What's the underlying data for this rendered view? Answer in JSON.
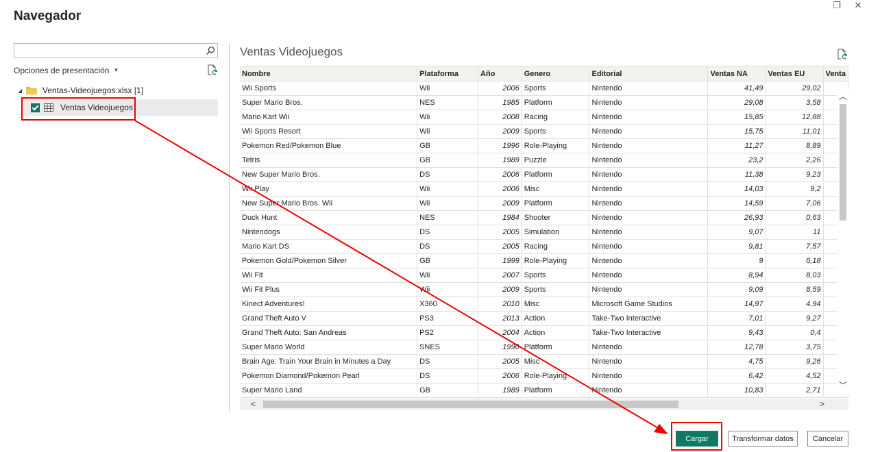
{
  "window": {
    "title": "Navegador"
  },
  "left_panel": {
    "search": {
      "value": "",
      "placeholder": ""
    },
    "display_options": "Opciones de presentación",
    "file": "Ventas-Videojuegos.xlsx [1]",
    "item": "Ventas Videojuegos"
  },
  "preview": {
    "title": "Ventas Videojuegos",
    "columns": [
      "Nombre",
      "Plataforma",
      "Año",
      "Genero",
      "Editorial",
      "Ventas NA",
      "Ventas EU",
      "Venta"
    ],
    "rows": [
      [
        "Wii Sports",
        "Wii",
        "2006",
        "Sports",
        "Nintendo",
        "41,49",
        "29,02"
      ],
      [
        "Super Mario Bros.",
        "NES",
        "1985",
        "Platform",
        "Nintendo",
        "29,08",
        "3,58"
      ],
      [
        "Mario Kart Wii",
        "Wii",
        "2008",
        "Racing",
        "Nintendo",
        "15,85",
        "12,88"
      ],
      [
        "Wii Sports Resort",
        "Wii",
        "2009",
        "Sports",
        "Nintendo",
        "15,75",
        "11,01"
      ],
      [
        "Pokemon Red/Pokemon Blue",
        "GB",
        "1996",
        "Role-Playing",
        "Nintendo",
        "11,27",
        "8,89"
      ],
      [
        "Tetris",
        "GB",
        "1989",
        "Puzzle",
        "Nintendo",
        "23,2",
        "2,26"
      ],
      [
        "New Super Mario Bros.",
        "DS",
        "2006",
        "Platform",
        "Nintendo",
        "11,38",
        "9,23"
      ],
      [
        "Wii Play",
        "Wii",
        "2006",
        "Misc",
        "Nintendo",
        "14,03",
        "9,2"
      ],
      [
        "New Super Mario Bros. Wii",
        "Wii",
        "2009",
        "Platform",
        "Nintendo",
        "14,59",
        "7,06"
      ],
      [
        "Duck Hunt",
        "NES",
        "1984",
        "Shooter",
        "Nintendo",
        "26,93",
        "0,63"
      ],
      [
        "Nintendogs",
        "DS",
        "2005",
        "Simulation",
        "Nintendo",
        "9,07",
        "11"
      ],
      [
        "Mario Kart DS",
        "DS",
        "2005",
        "Racing",
        "Nintendo",
        "9,81",
        "7,57"
      ],
      [
        "Pokemon Gold/Pokemon Silver",
        "GB",
        "1999",
        "Role-Playing",
        "Nintendo",
        "9",
        "6,18"
      ],
      [
        "Wii Fit",
        "Wii",
        "2007",
        "Sports",
        "Nintendo",
        "8,94",
        "8,03"
      ],
      [
        "Wii Fit Plus",
        "Wii",
        "2009",
        "Sports",
        "Nintendo",
        "9,09",
        "8,59"
      ],
      [
        "Kinect Adventures!",
        "X360",
        "2010",
        "Misc",
        "Microsoft Game Studios",
        "14,97",
        "4,94"
      ],
      [
        "Grand Theft Auto V",
        "PS3",
        "2013",
        "Action",
        "Take-Two Interactive",
        "7,01",
        "9,27"
      ],
      [
        "Grand Theft Auto: San Andreas",
        "PS2",
        "2004",
        "Action",
        "Take-Two Interactive",
        "9,43",
        "0,4"
      ],
      [
        "Super Mario World",
        "SNES",
        "1990",
        "Platform",
        "Nintendo",
        "12,78",
        "3,75"
      ],
      [
        "Brain Age: Train Your Brain in Minutes a Day",
        "DS",
        "2005",
        "Misc",
        "Nintendo",
        "4,75",
        "9,26"
      ],
      [
        "Pokemon Diamond/Pokemon Pearl",
        "DS",
        "2006",
        "Role-Playing",
        "Nintendo",
        "6,42",
        "4,52"
      ],
      [
        "Super Mario Land",
        "GB",
        "1989",
        "Platform",
        "Nintendo",
        "10,83",
        "2,71"
      ]
    ]
  },
  "buttons": {
    "load": "Cargar",
    "transform": "Transformar datos",
    "cancel": "Cancelar"
  },
  "colors": {
    "accent": "#117865",
    "annotation": "#e00000",
    "selected_bg": "#ebebeb"
  }
}
